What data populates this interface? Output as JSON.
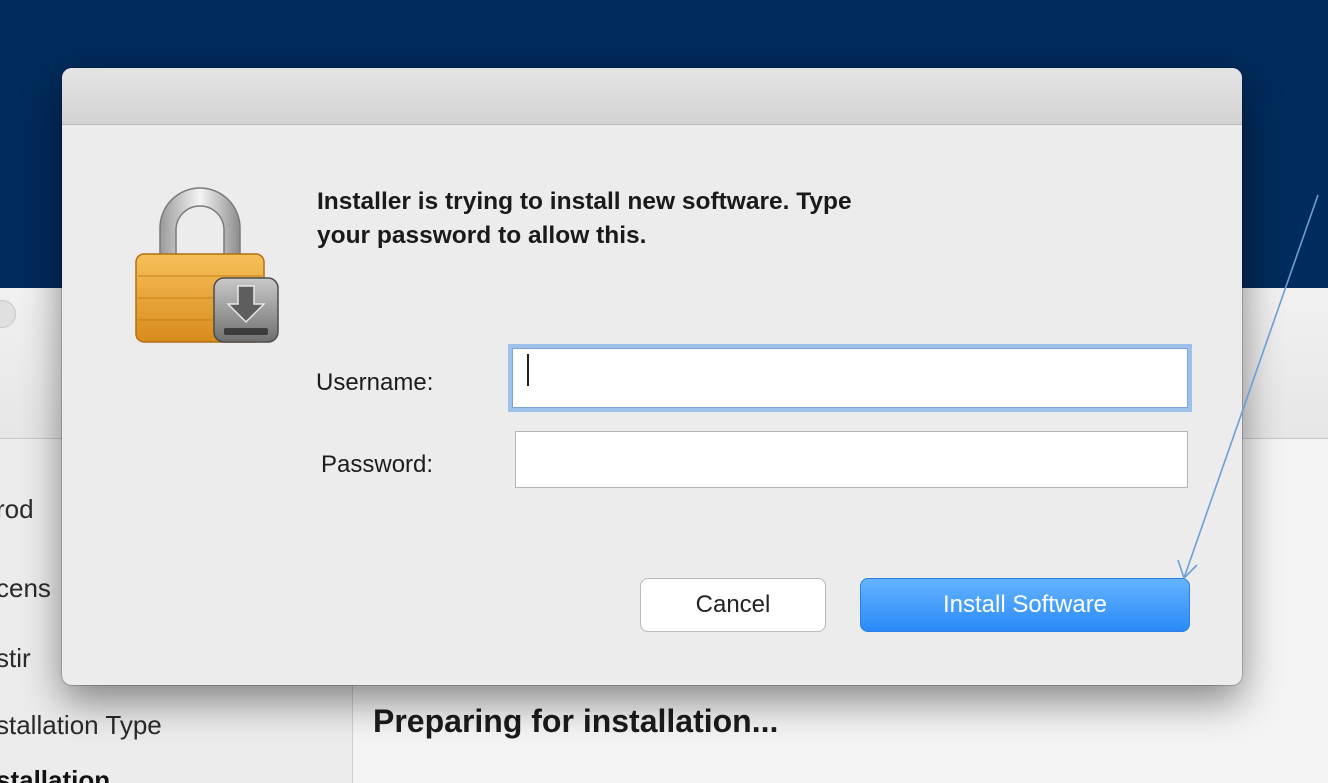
{
  "installer": {
    "sidebar_items": [
      "rod",
      "cens",
      "stir",
      "stallation Type",
      "stallation"
    ],
    "status": "Preparing for installation..."
  },
  "dialog": {
    "message": "Installer is trying to install new software. Type your password to allow this.",
    "username_label": "Username:",
    "password_label": "Password:",
    "username_value": "",
    "password_value": "",
    "cancel_label": "Cancel",
    "install_label": "Install Software",
    "lock_icon": "lock-download-icon"
  },
  "colors": {
    "header_band": "#002b5c",
    "primary_button": "#2a8af8",
    "focus_ring": "#9ec1ec",
    "annotation_arrow": "#6a9fd8"
  }
}
